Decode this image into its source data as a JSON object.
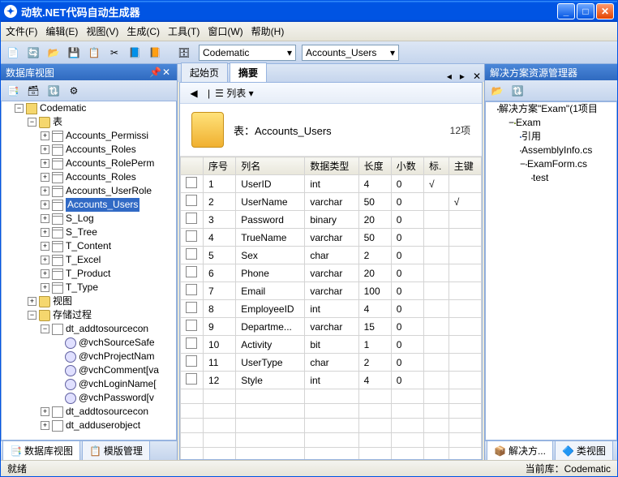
{
  "window": {
    "title": "动软.NET代码自动生成器"
  },
  "menu": {
    "file": "文件(F)",
    "edit": "编辑(E)",
    "view": "视图(V)",
    "build": "生成(C)",
    "tools": "工具(T)",
    "window": "窗口(W)",
    "help": "帮助(H)"
  },
  "toolbar": {
    "db": "Codematic",
    "table": "Accounts_Users"
  },
  "left": {
    "title": "数据库视图",
    "root": "Codematic",
    "tables_label": "表",
    "tables": [
      "Accounts_Permissi",
      "Accounts_Roles",
      "Accounts_RolePerm",
      "Accounts_Roles",
      "Accounts_UserRole",
      "Accounts_Users",
      "S_Log",
      "S_Tree",
      "T_Content",
      "T_Excel",
      "T_Product",
      "T_Type"
    ],
    "selected": "Accounts_Users",
    "views_label": "视图",
    "sp_label": "存储过程",
    "sps": [
      "dt_addtosourcecon"
    ],
    "params": [
      "@vchSourceSafe",
      "@vchProjectNam",
      "@vchComment[va",
      "@vchLoginName[",
      "@vchPassword[v"
    ],
    "sps2": [
      "dt_addtosourcecon",
      "dt_adduserobject"
    ],
    "tab1": "数据库视图",
    "tab2": "模版管理"
  },
  "center": {
    "tab_start": "起始页",
    "tab_summary": "摘要",
    "list_label": "列表",
    "table_title": "表：Accounts_Users",
    "count": "12项",
    "cols": {
      "idx": "序号",
      "name": "列名",
      "type": "数据类型",
      "len": "长度",
      "dec": "小数",
      "mark": "标.",
      "pk": "主键"
    },
    "rows": [
      {
        "idx": "1",
        "name": "UserID",
        "type": "int",
        "len": "4",
        "dec": "0",
        "mark": "√",
        "pk": ""
      },
      {
        "idx": "2",
        "name": "UserName",
        "type": "varchar",
        "len": "50",
        "dec": "0",
        "mark": "",
        "pk": "√"
      },
      {
        "idx": "3",
        "name": "Password",
        "type": "binary",
        "len": "20",
        "dec": "0",
        "mark": "",
        "pk": ""
      },
      {
        "idx": "4",
        "name": "TrueName",
        "type": "varchar",
        "len": "50",
        "dec": "0",
        "mark": "",
        "pk": ""
      },
      {
        "idx": "5",
        "name": "Sex",
        "type": "char",
        "len": "2",
        "dec": "0",
        "mark": "",
        "pk": ""
      },
      {
        "idx": "6",
        "name": "Phone",
        "type": "varchar",
        "len": "20",
        "dec": "0",
        "mark": "",
        "pk": ""
      },
      {
        "idx": "7",
        "name": "Email",
        "type": "varchar",
        "len": "100",
        "dec": "0",
        "mark": "",
        "pk": ""
      },
      {
        "idx": "8",
        "name": "EmployeeID",
        "type": "int",
        "len": "4",
        "dec": "0",
        "mark": "",
        "pk": ""
      },
      {
        "idx": "9",
        "name": "Departme...",
        "type": "varchar",
        "len": "15",
        "dec": "0",
        "mark": "",
        "pk": ""
      },
      {
        "idx": "10",
        "name": "Activity",
        "type": "bit",
        "len": "1",
        "dec": "0",
        "mark": "",
        "pk": ""
      },
      {
        "idx": "11",
        "name": "UserType",
        "type": "char",
        "len": "2",
        "dec": "0",
        "mark": "",
        "pk": ""
      },
      {
        "idx": "12",
        "name": "Style",
        "type": "int",
        "len": "4",
        "dec": "0",
        "mark": "",
        "pk": ""
      }
    ]
  },
  "right": {
    "title": "解决方案资源管理器",
    "sln": "解决方案\"Exam\"(1项目",
    "proj": "Exam",
    "ref": "引用",
    "asm": "AssemblyInfo.cs",
    "form": "ExamForm.cs",
    "test": "test",
    "tab1": "解决方...",
    "tab2": "类视图"
  },
  "status": {
    "ready": "就绪",
    "db": "当前库：Codematic"
  }
}
